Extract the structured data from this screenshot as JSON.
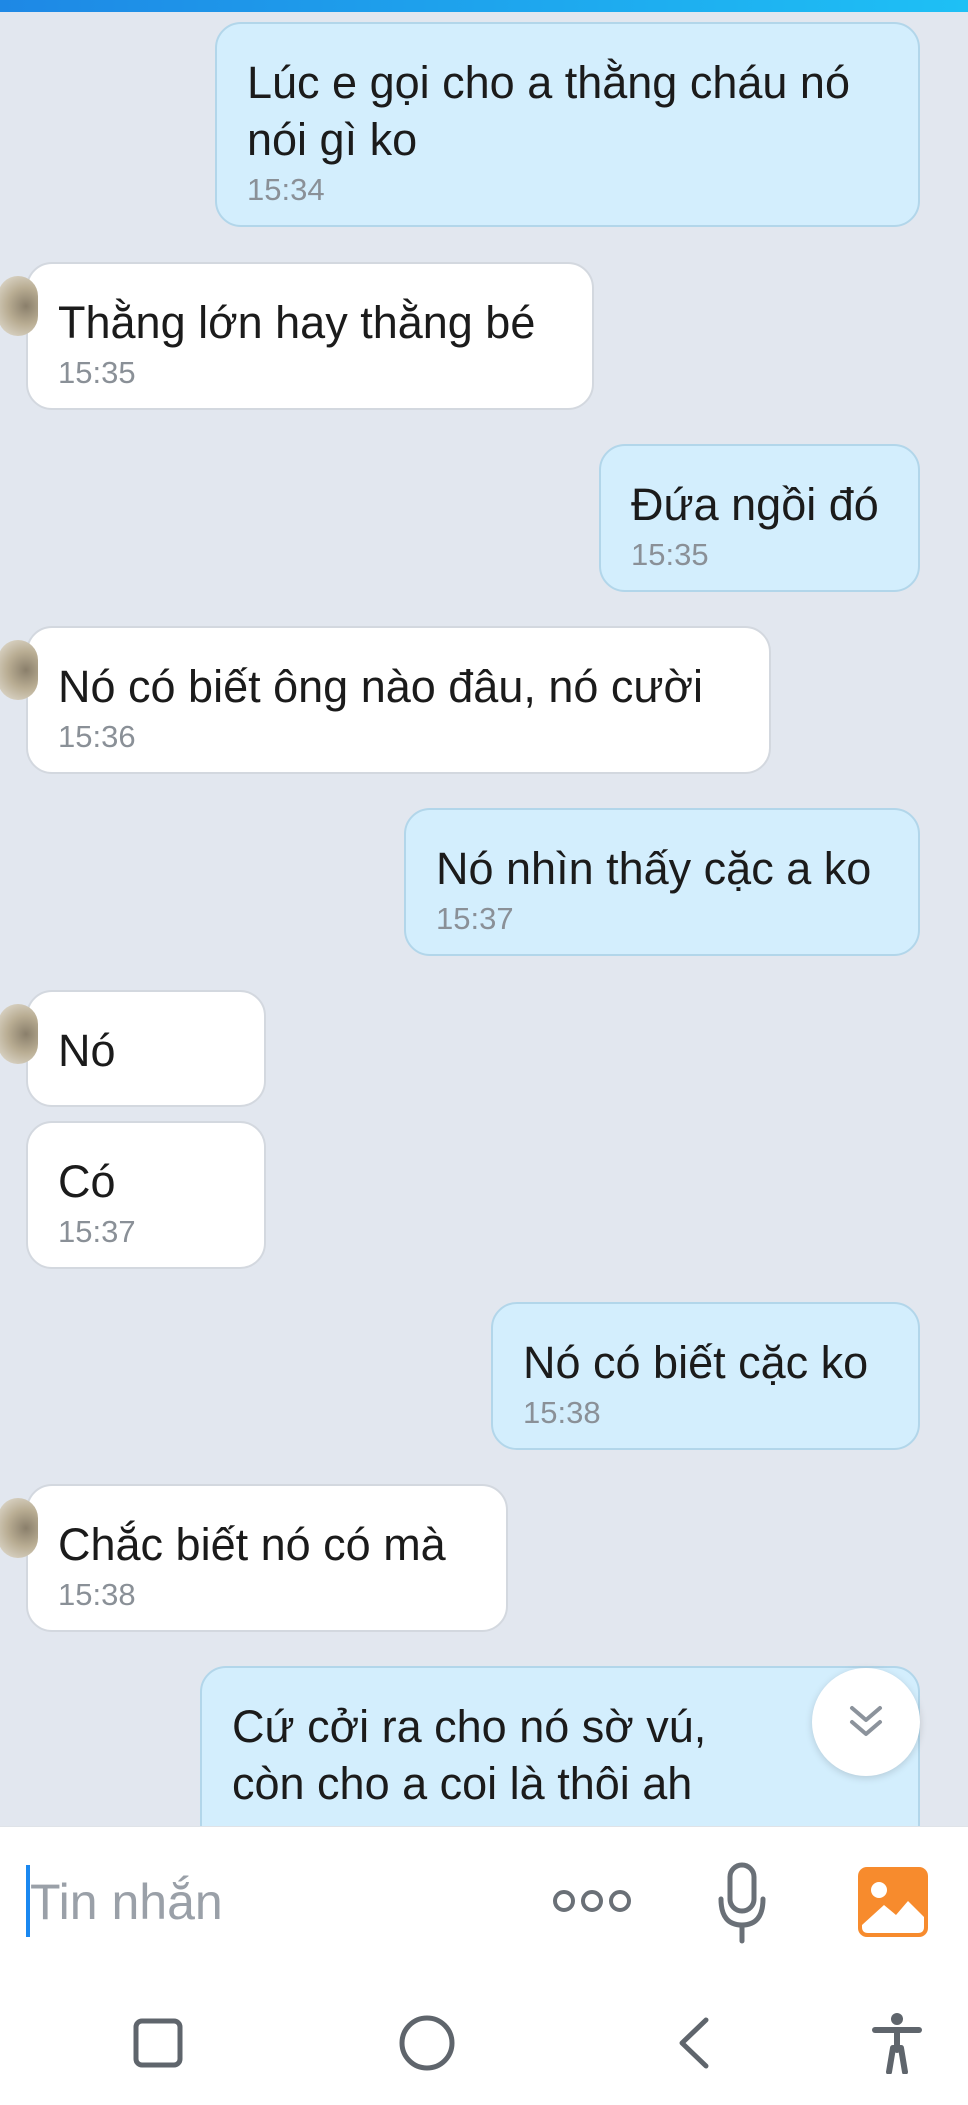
{
  "messages": [
    {
      "side": "me",
      "text": "Lúc e gọi cho a thằng cháu nó nói gì ko",
      "time": "15:34"
    },
    {
      "side": "them",
      "text": "Thằng lớn hay thằng bé",
      "time": "15:35"
    },
    {
      "side": "me",
      "text": "Đứa ngồi đó",
      "time": "15:35"
    },
    {
      "side": "them",
      "text": "Nó có biết ông nào đâu, nó cười",
      "time": "15:36"
    },
    {
      "side": "me",
      "text": "Nó nhìn thấy cặc a ko",
      "time": "15:37"
    },
    {
      "side": "them",
      "text": "Nó",
      "time": ""
    },
    {
      "side": "them",
      "text": "Có",
      "time": "15:37"
    },
    {
      "side": "me",
      "text": "Nó có biết cặc ko",
      "time": "15:38"
    },
    {
      "side": "them",
      "text": "Chắc biết nó có mà",
      "time": "15:38"
    },
    {
      "side": "me",
      "text": "Cứ cởi ra cho nó sờ vú, còn cho a coi là thôi ah",
      "time": ""
    }
  ],
  "composer": {
    "placeholder": "Tin nhắn",
    "icons": [
      "more-icon",
      "microphone-icon",
      "gallery-icon"
    ]
  },
  "colors": {
    "chat_background": "#e2e7ef",
    "outgoing_bubble": "#d3eefd",
    "incoming_bubble": "#ffffff",
    "accent": "#1a88f0",
    "gallery_icon": "#f78b2d"
  },
  "navigation": [
    "recent-apps-icon",
    "home-icon",
    "back-icon",
    "accessibility-icon"
  ]
}
